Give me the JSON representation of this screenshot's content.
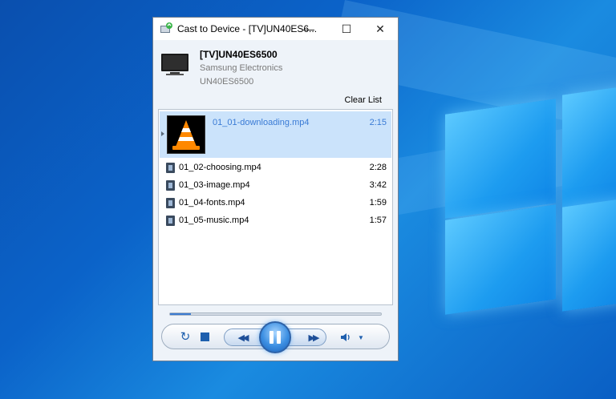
{
  "window": {
    "title": "Cast to Device - [TV]UN40ES6...",
    "minimize_glyph": "—",
    "maximize_glyph": "☐",
    "close_glyph": "✕"
  },
  "device": {
    "name": "[TV]UN40ES6500",
    "manufacturer": "Samsung Electronics",
    "model": "UN40ES6500"
  },
  "playlist": {
    "clear_label": "Clear List",
    "items": [
      {
        "name": "01_01-downloading.mp4",
        "duration": "2:15"
      },
      {
        "name": "01_02-choosing.mp4",
        "duration": "2:28"
      },
      {
        "name": "01_03-image.mp4",
        "duration": "3:42"
      },
      {
        "name": "01_04-fonts.mp4",
        "duration": "1:59"
      },
      {
        "name": "01_05-music.mp4",
        "duration": "1:57"
      }
    ]
  },
  "playback": {
    "progress_fraction": 0.1
  },
  "controls": {
    "repeat_icon": "↻",
    "prev_icon": "◀◀",
    "next_icon": "▶▶",
    "volume_icon": "🔈",
    "volume_menu_icon": "▼"
  },
  "colors": {
    "accent": "#3a7bd5",
    "selection": "#cbe3fb"
  }
}
